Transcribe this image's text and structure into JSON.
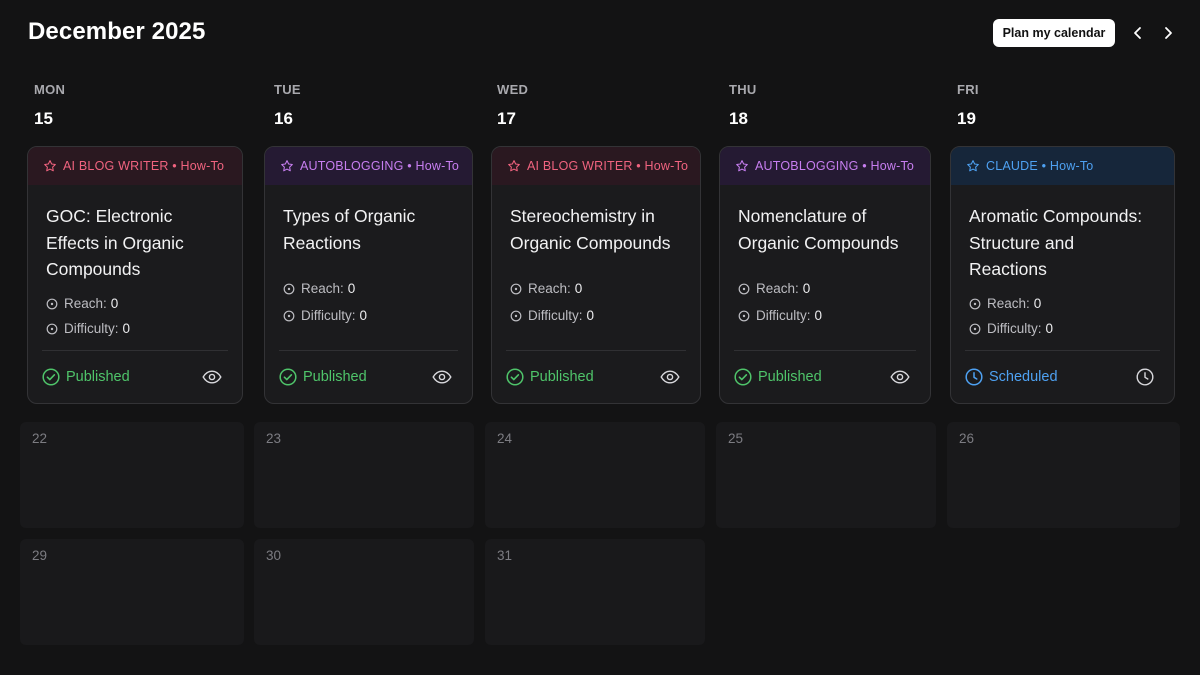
{
  "header": {
    "title": "December 2025",
    "plan_label": "Plan my calendar"
  },
  "days": [
    {
      "dow": "MON",
      "num": "15"
    },
    {
      "dow": "TUE",
      "num": "16"
    },
    {
      "dow": "WED",
      "num": "17"
    },
    {
      "dow": "THU",
      "num": "18"
    },
    {
      "dow": "FRI",
      "num": "19"
    }
  ],
  "cards": [
    {
      "source": "AI BLOG WRITER",
      "type": "How-To",
      "title_lines": [
        "GOC: Electronic",
        "Effects in Organic",
        "Compounds"
      ],
      "reach_label": "Reach:",
      "reach": "0",
      "difficulty_label": "Difficulty:",
      "difficulty": "0",
      "status": "Published"
    },
    {
      "source": "AUTOBLOGGING",
      "type": "How-To",
      "title_lines": [
        "Types of Organic",
        "Reactions"
      ],
      "reach_label": "Reach:",
      "reach": "0",
      "difficulty_label": "Difficulty:",
      "difficulty": "0",
      "status": "Published"
    },
    {
      "source": "AI BLOG WRITER",
      "type": "How-To",
      "title_lines": [
        "Stereochemistry in",
        "Organic Compounds"
      ],
      "reach_label": "Reach:",
      "reach": "0",
      "difficulty_label": "Difficulty:",
      "difficulty": "0",
      "status": "Published"
    },
    {
      "source": "AUTOBLOGGING",
      "type": "How-To",
      "title_lines": [
        "Nomenclature of",
        "Organic Compounds"
      ],
      "reach_label": "Reach:",
      "reach": "0",
      "difficulty_label": "Difficulty:",
      "difficulty": "0",
      "status": "Published"
    },
    {
      "source": "CLAUDE",
      "type": "How-To",
      "title_lines": [
        "Aromatic Compounds:",
        "Structure and",
        "Reactions"
      ],
      "reach_label": "Reach:",
      "reach": "0",
      "difficulty_label": "Difficulty:",
      "difficulty": "0",
      "status": "Scheduled"
    }
  ],
  "week2": [
    "22",
    "23",
    "24",
    "25",
    "26"
  ],
  "week3": [
    "29",
    "30",
    "31"
  ],
  "colors": {
    "ai_blog_writer": "#f0637f",
    "autoblogging": "#c77ef0",
    "claude": "#4ea1f2",
    "published": "#4fc46a",
    "scheduled": "#4ea1f2"
  },
  "icons": {
    "prev": "chevron-left-icon",
    "next": "chevron-right-icon",
    "source": "star-icon",
    "metric": "circle-dot-icon",
    "published": "check-circle-icon",
    "scheduled": "clock-icon",
    "view": "eye-icon"
  }
}
